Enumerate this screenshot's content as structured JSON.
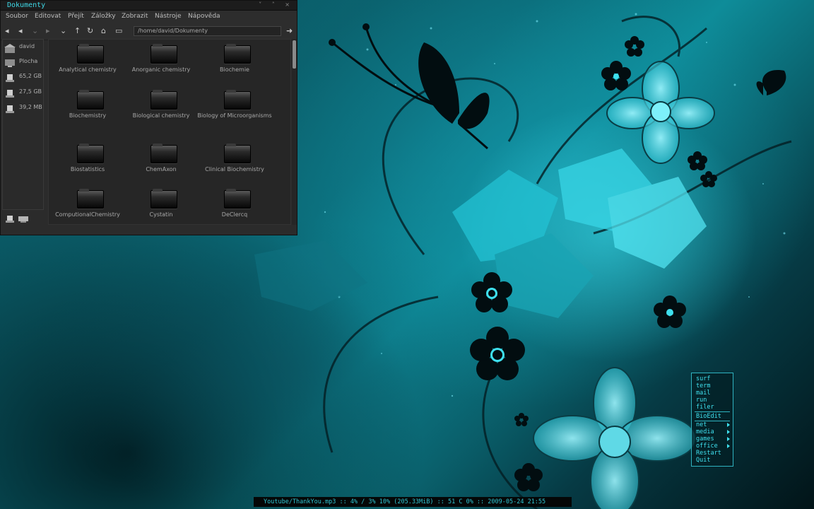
{
  "window": {
    "title": "Dokumenty",
    "controls": "˅ ˄ ×",
    "menu": [
      "Soubor",
      "Editovat",
      "Přejít",
      "Záložky",
      "Zobrazit",
      "Nástroje",
      "Nápověda"
    ],
    "location": "/home/david/Dokumenty",
    "sidebar": [
      {
        "label": "david",
        "icon": "home-icon"
      },
      {
        "label": "Plocha",
        "icon": "desktop-icon"
      },
      {
        "label": "65,2 GB",
        "icon": "drive-icon"
      },
      {
        "label": "27,5 GB",
        "icon": "drive-icon"
      },
      {
        "label": "39,2 MB",
        "icon": "drive-icon"
      }
    ],
    "folders": [
      "Analytical chemistry",
      "Anorganic chemistry",
      "Biochemie",
      "Biochemistry",
      "Biological chemistry",
      "Biology of Microorganisms",
      "Biostatistics",
      "ChemAxon",
      "Clinical Biochemistry",
      "ComputionalChemistry",
      "Cystatin",
      "DeClercq"
    ]
  },
  "menu": {
    "items": [
      "surf",
      "term",
      "mail",
      "run",
      "filer"
    ],
    "extra": "BioEdit",
    "submenus": [
      "net",
      "media",
      "games",
      "office"
    ],
    "actions": [
      "Restart",
      "Quit"
    ]
  },
  "status": "Youtube/ThankYou.mp3 :: 4% / 3% 10% (205.33MiB) :: 51 C 0% :: 2009-05-24 21:55",
  "colors": {
    "accent": "#3fe0ee",
    "panel": "#2b2b2b"
  }
}
